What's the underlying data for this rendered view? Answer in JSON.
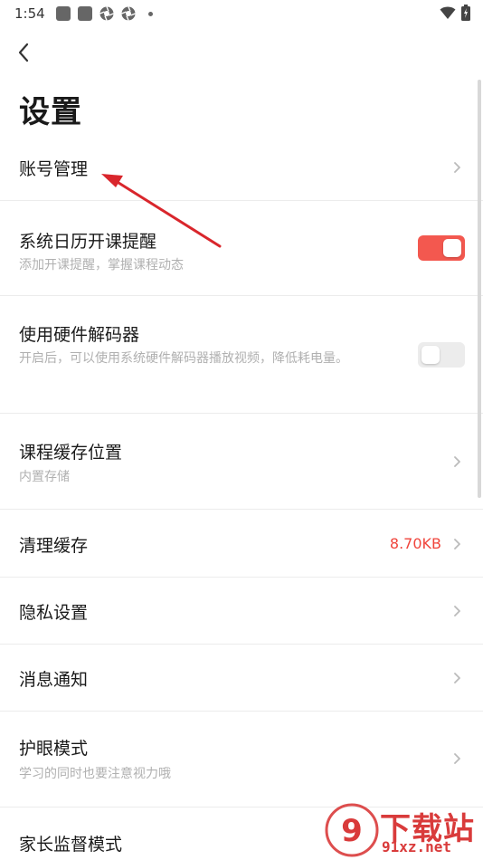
{
  "status_bar": {
    "time": "1:54",
    "icons_left": [
      "square-icon",
      "square-icon",
      "aperture-icon",
      "aperture-icon",
      "dot-icon"
    ],
    "icons_right": [
      "wifi-icon",
      "battery-icon"
    ]
  },
  "header": {
    "back_icon": "chevron-left-icon",
    "title": "设置"
  },
  "settings": {
    "items": [
      {
        "title": "账号管理",
        "subtitle": "",
        "control": "chevron"
      },
      {
        "title": "系统日历开课提醒",
        "subtitle": "添加开课提醒，掌握课程动态",
        "control": "toggle",
        "toggle_on": true
      },
      {
        "title": "使用硬件解码器",
        "subtitle": "开启后，可以使用系统硬件解码器播放视频，降低耗电量。",
        "control": "toggle",
        "toggle_on": false
      },
      {
        "title": "课程缓存位置",
        "subtitle": "内置存储",
        "control": "chevron"
      },
      {
        "title": "清理缓存",
        "subtitle": "",
        "control": "chevron",
        "value": "8.70KB"
      },
      {
        "title": "隐私设置",
        "subtitle": "",
        "control": "chevron"
      },
      {
        "title": "消息通知",
        "subtitle": "",
        "control": "chevron"
      },
      {
        "title": "护眼模式",
        "subtitle": "学习的同时也要注意视力哦",
        "control": "chevron"
      },
      {
        "title": "家长监督模式",
        "subtitle": "",
        "control": "chevron"
      }
    ]
  },
  "colors": {
    "accent": "#f3584f",
    "value_text": "#f0453c",
    "subtitle": "#b0b0b0",
    "annotation_arrow": "#d9262c"
  },
  "watermark": {
    "logo_icon": "download-site-logo-icon",
    "top_text": "下载站",
    "bottom_text": "91xz.net"
  }
}
